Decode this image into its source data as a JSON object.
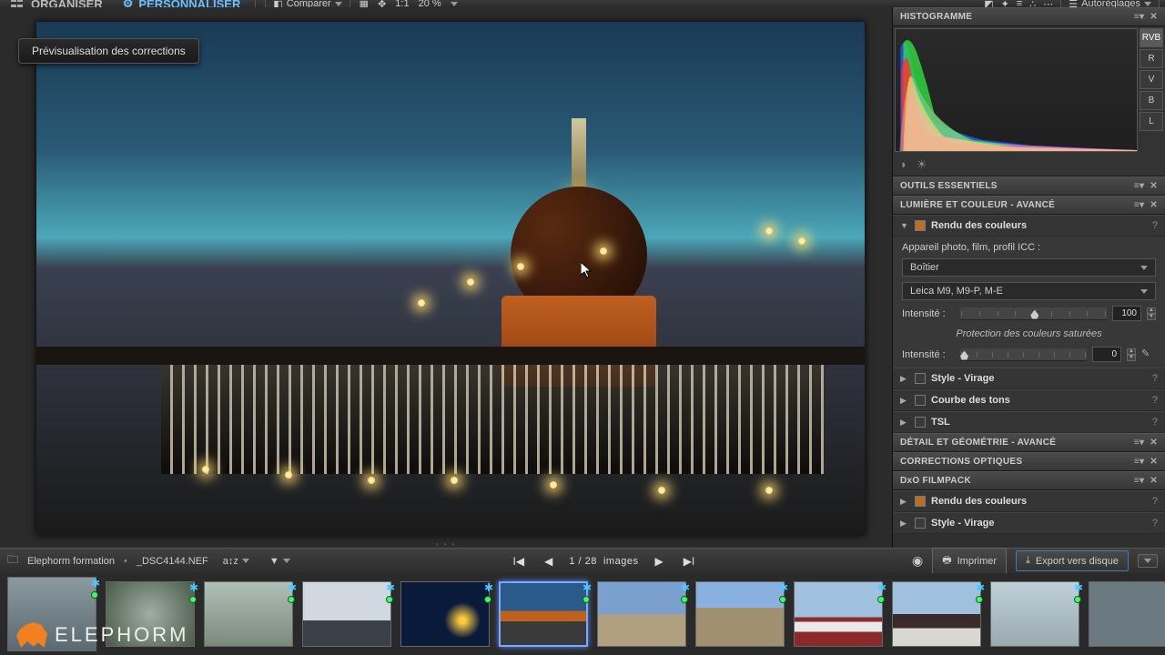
{
  "topbar": {
    "organize": "ORGANISER",
    "customize": "PERSONNALISER",
    "compare": "Comparer",
    "ratio": "1:1",
    "zoom": "20 %",
    "autosettings": "Autoréglages"
  },
  "tooltip": "Prévisualisation des corrections",
  "side": {
    "histogram": {
      "title": "HISTOGRAMME",
      "tabs": [
        "RVB",
        "R",
        "V",
        "B",
        "L"
      ],
      "active": "RVB"
    },
    "essentials": {
      "title": "OUTILS ESSENTIELS"
    },
    "lightcolor": {
      "title": "LUMIÈRE ET COULEUR - AVANCÉ",
      "rendu": {
        "title": "Rendu des couleurs",
        "profile_label": "Appareil photo, film, profil ICC :",
        "profile_value": "Boîtier",
        "camera_value": "Leica M9, M9-P, M-E",
        "intensity_label": "Intensité :",
        "intensity_value": "100",
        "protection_note": "Protection des couleurs saturées",
        "intensity2_label": "Intensité :",
        "intensity2_value": "0"
      },
      "style": "Style - Virage",
      "curve": "Courbe des tons",
      "tsl": "TSL"
    },
    "detail": {
      "title": "DÉTAIL ET GÉOMÉTRIE - AVANCÉ"
    },
    "optical": {
      "title": "CORRECTIONS OPTIQUES"
    },
    "filmpack": {
      "title": "DxO FILMPACK",
      "rendu": "Rendu des couleurs",
      "style": "Style - Virage"
    }
  },
  "status": {
    "folder": "Elephorm formation",
    "file": "_DSC4144.NEF",
    "pos": "1 / 28",
    "images_word": "images",
    "print": "Imprimer",
    "export": "Export vers disque"
  },
  "brand": "ELEPHORM",
  "thumbs_count": 12,
  "selected_thumb": 6
}
